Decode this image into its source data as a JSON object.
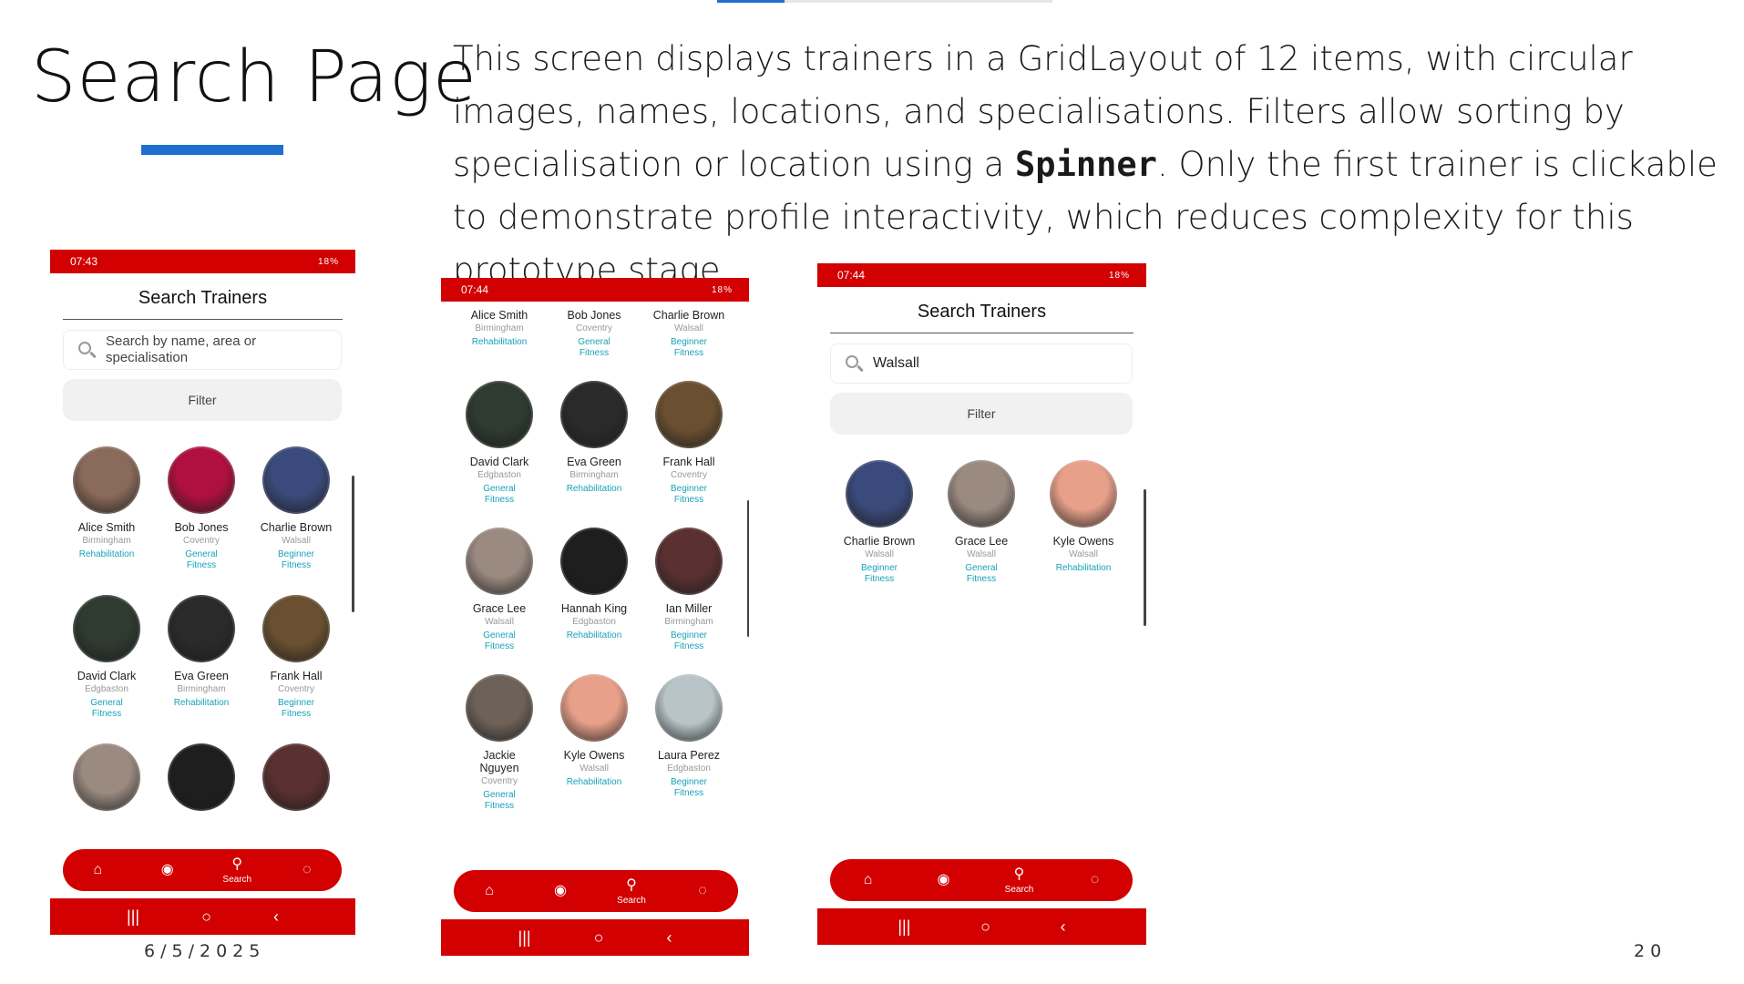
{
  "slide": {
    "title": "Search Page",
    "description_parts": [
      "This screen displays trainers in a GridLayout of 12 items, with circular images, names, locations, and specialisations. Filters allow sorting by specialisation or location using a ",
      "Spinner",
      ". Only the first trainer is clickable to demonstrate profile interactivity, which reduces complexity for this prototype stage."
    ],
    "date": "6/5/2025",
    "page_number": "20"
  },
  "phone1": {
    "status_time": "07:43",
    "status_battery": "18%",
    "title": "Search Trainers",
    "search_placeholder": "Search by name, area or specialisation",
    "filter_label": "Filter",
    "trainers": [
      {
        "name": "Alice Smith",
        "location": "Birmingham",
        "spec": "Rehabilitation",
        "color": "#8a6a5a"
      },
      {
        "name": "Bob Jones",
        "location": "Coventry",
        "spec": "General Fitness",
        "color": "#b01040"
      },
      {
        "name": "Charlie Brown",
        "location": "Walsall",
        "spec": "Beginner Fitness",
        "color": "#3a4a7a"
      },
      {
        "name": "David Clark",
        "location": "Edgbaston",
        "spec": "General Fitness",
        "color": "#2f3a30"
      },
      {
        "name": "Eva Green",
        "location": "Birmingham",
        "spec": "Rehabilitation",
        "color": "#2a2a2a"
      },
      {
        "name": "Frank Hall",
        "location": "Coventry",
        "spec": "Beginner Fitness",
        "color": "#6a5030"
      },
      {
        "name": "",
        "location": "",
        "spec": "",
        "color": "#9a8a80"
      },
      {
        "name": "",
        "location": "",
        "spec": "",
        "color": "#1e1e1e"
      },
      {
        "name": "",
        "location": "",
        "spec": "",
        "color": "#5a3030"
      }
    ],
    "nav": {
      "home": "⌂",
      "profile": "◉",
      "search": "⚲",
      "search_label": "Search",
      "chat": "◌"
    }
  },
  "phone2": {
    "status_time": "07:44",
    "status_battery": "18%",
    "trainers": [
      {
        "name": "Alice Smith",
        "location": "Birmingham",
        "spec": "Rehabilitation",
        "color": ""
      },
      {
        "name": "Bob Jones",
        "location": "Coventry",
        "spec": "General Fitness",
        "color": ""
      },
      {
        "name": "Charlie Brown",
        "location": "Walsall",
        "spec": "Beginner Fitness",
        "color": ""
      },
      {
        "name": "David Clark",
        "location": "Edgbaston",
        "spec": "General Fitness",
        "color": "#2f3a30"
      },
      {
        "name": "Eva Green",
        "location": "Birmingham",
        "spec": "Rehabilitation",
        "color": "#2a2a2a"
      },
      {
        "name": "Frank Hall",
        "location": "Coventry",
        "spec": "Beginner Fitness",
        "color": "#6a5030"
      },
      {
        "name": "Grace Lee",
        "location": "Walsall",
        "spec": "General Fitness",
        "color": "#9a8a80"
      },
      {
        "name": "Hannah King",
        "location": "Edgbaston",
        "spec": "Rehabilitation",
        "color": "#1e1e1e"
      },
      {
        "name": "Ian Miller",
        "location": "Birmingham",
        "spec": "Beginner Fitness",
        "color": "#5a3030"
      },
      {
        "name": "Jackie Nguyen",
        "location": "Coventry",
        "spec": "General Fitness",
        "color": "#6e6258"
      },
      {
        "name": "Kyle Owens",
        "location": "Walsall",
        "spec": "Rehabilitation",
        "color": "#e8a08a"
      },
      {
        "name": "Laura Perez",
        "location": "Edgbaston",
        "spec": "Beginner Fitness",
        "color": "#b8c4c8"
      }
    ],
    "nav": {
      "home": "⌂",
      "profile": "◉",
      "search": "⚲",
      "search_label": "Search",
      "chat": "◌"
    }
  },
  "phone3": {
    "status_time": "07:44",
    "status_battery": "18%",
    "title": "Search Trainers",
    "search_value": "Walsall",
    "filter_label": "Filter",
    "trainers": [
      {
        "name": "Charlie Brown",
        "location": "Walsall",
        "spec": "Beginner Fitness",
        "color": "#3a4a7a"
      },
      {
        "name": "Grace Lee",
        "location": "Walsall",
        "spec": "General Fitness",
        "color": "#9a8a80"
      },
      {
        "name": "Kyle Owens",
        "location": "Walsall",
        "spec": "Rehabilitation",
        "color": "#e8a08a"
      }
    ],
    "nav": {
      "home": "⌂",
      "profile": "◉",
      "search": "⚲",
      "search_label": "Search",
      "chat": "◌"
    }
  },
  "system_nav": {
    "recents": "|||",
    "home": "○",
    "back": "‹"
  }
}
